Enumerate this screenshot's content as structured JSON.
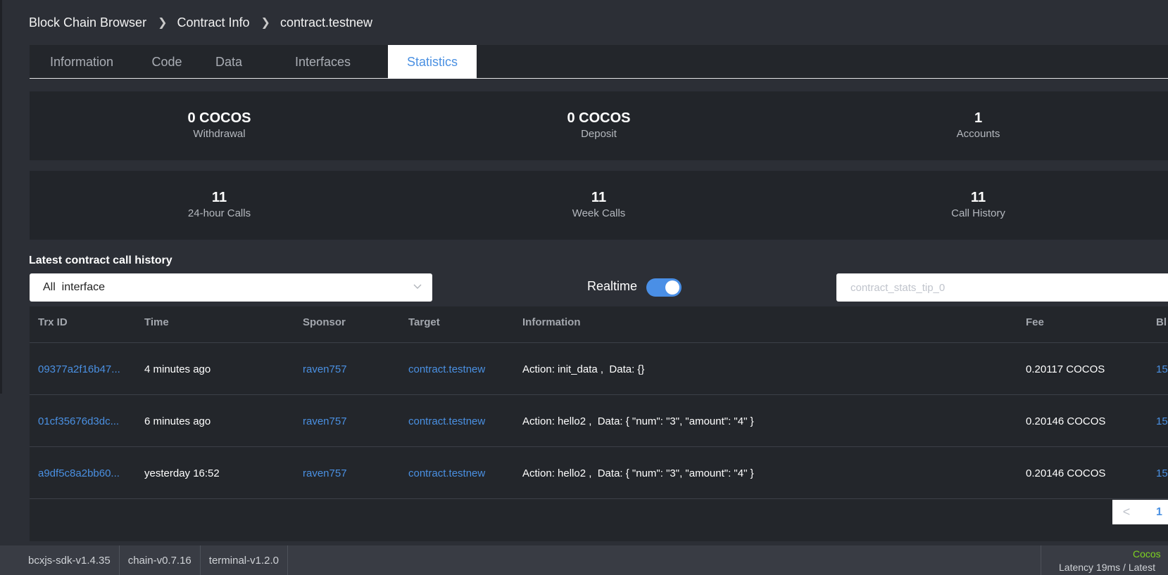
{
  "breadcrumb": {
    "items": [
      "Block Chain Browser",
      "Contract Info",
      "contract.testnew"
    ]
  },
  "tabs": [
    {
      "label": "Information",
      "active": false
    },
    {
      "label": "Code",
      "active": false
    },
    {
      "label": "Data",
      "active": false
    },
    {
      "label": "Interfaces",
      "active": false
    },
    {
      "label": "Statistics",
      "active": true
    }
  ],
  "stats": {
    "withdrawal": {
      "value": "0 COCOS",
      "label": "Withdrawal"
    },
    "deposit": {
      "value": "0 COCOS",
      "label": "Deposit"
    },
    "accounts": {
      "value": "1",
      "label": "Accounts"
    },
    "calls_24h": {
      "value": "11",
      "label": "24-hour Calls"
    },
    "calls_week": {
      "value": "11",
      "label": "Week Calls"
    },
    "call_history": {
      "value": "11",
      "label": "Call History"
    }
  },
  "history": {
    "title": "Latest contract call history",
    "filter_value": "All  interface",
    "realtime_label": "Realtime",
    "realtime_on": true,
    "search_placeholder": "contract_stats_tip_0"
  },
  "table": {
    "headers": [
      "Trx ID",
      "Time",
      "Sponsor",
      "Target",
      "Information",
      "Fee",
      "Bl"
    ],
    "rows": [
      {
        "trx_id": "09377a2f16b47...",
        "time": "4 minutes ago",
        "sponsor": "raven757",
        "target": "contract.testnew",
        "information": "Action: init_data ,  Data: {}",
        "fee": "0.20117 COCOS",
        "block": "15"
      },
      {
        "trx_id": "01cf35676d3dc...",
        "time": "6 minutes ago",
        "sponsor": "raven757",
        "target": "contract.testnew",
        "information": "Action: hello2 ,  Data: { \"num\": \"3\", \"amount\": \"4\" }",
        "fee": "0.20146 COCOS",
        "block": "15"
      },
      {
        "trx_id": "a9df5c8a2bb60...",
        "time": "yesterday 16:52",
        "sponsor": "raven757",
        "target": "contract.testnew",
        "information": "Action: hello2 ,  Data: { \"num\": \"3\", \"amount\": \"4\" }",
        "fee": "0.20146 COCOS",
        "block": "15"
      }
    ]
  },
  "pagination": {
    "prev_icon": "<",
    "current": "1"
  },
  "footer": {
    "versions": [
      "bcxjs-sdk-v1.4.35",
      "chain-v0.7.16",
      "terminal-v1.2.0"
    ],
    "network": "Cocos",
    "latency": "Latency 19ms / Latest"
  },
  "colors": {
    "accent": "#4a90e2",
    "network_ok": "#7ed321"
  }
}
